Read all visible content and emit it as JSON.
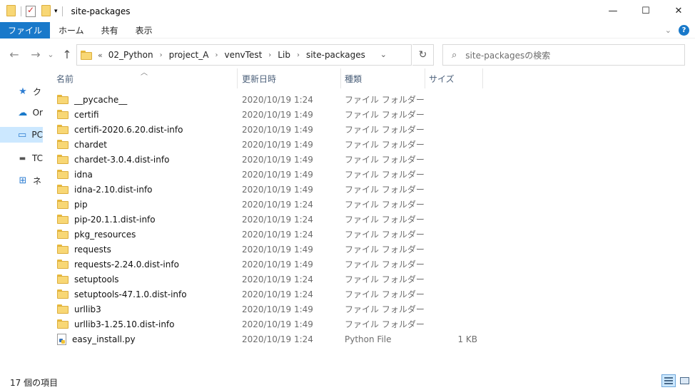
{
  "window": {
    "title": "site-packages",
    "controls": {
      "minimize": "—",
      "maximize": "☐",
      "close": "✕"
    }
  },
  "ribbon": {
    "tabs": [
      "ファイル",
      "ホーム",
      "共有",
      "表示"
    ],
    "help": "?"
  },
  "nav": {
    "back": "←",
    "forward": "→",
    "recent": "⌄",
    "up": "↑",
    "overflow": "«",
    "breadcrumbs": [
      "02_Python",
      "project_A",
      "venvTest",
      "Lib",
      "site-packages"
    ],
    "refresh": "↻",
    "search_placeholder": "site-packagesの検索"
  },
  "navpane": {
    "items": [
      {
        "label": "ク",
        "icon": "star-icon"
      },
      {
        "label": "Or",
        "icon": "cloud-icon"
      },
      {
        "label": "PC",
        "icon": "monitor-icon",
        "selected": true
      },
      {
        "label": "TC",
        "icon": "drive-icon"
      },
      {
        "label": "ネ",
        "icon": "network-icon"
      }
    ]
  },
  "columns": {
    "name": "名前",
    "date": "更新日時",
    "type": "種類",
    "size": "サイズ"
  },
  "files": [
    {
      "name": "__pycache__",
      "date": "2020/10/19 1:24",
      "type": "ファイル フォルダー",
      "size": "",
      "icon": "folder-icon"
    },
    {
      "name": "certifi",
      "date": "2020/10/19 1:49",
      "type": "ファイル フォルダー",
      "size": "",
      "icon": "folder-icon"
    },
    {
      "name": "certifi-2020.6.20.dist-info",
      "date": "2020/10/19 1:49",
      "type": "ファイル フォルダー",
      "size": "",
      "icon": "folder-icon"
    },
    {
      "name": "chardet",
      "date": "2020/10/19 1:49",
      "type": "ファイル フォルダー",
      "size": "",
      "icon": "folder-icon"
    },
    {
      "name": "chardet-3.0.4.dist-info",
      "date": "2020/10/19 1:49",
      "type": "ファイル フォルダー",
      "size": "",
      "icon": "folder-icon"
    },
    {
      "name": "idna",
      "date": "2020/10/19 1:49",
      "type": "ファイル フォルダー",
      "size": "",
      "icon": "folder-icon"
    },
    {
      "name": "idna-2.10.dist-info",
      "date": "2020/10/19 1:49",
      "type": "ファイル フォルダー",
      "size": "",
      "icon": "folder-icon"
    },
    {
      "name": "pip",
      "date": "2020/10/19 1:24",
      "type": "ファイル フォルダー",
      "size": "",
      "icon": "folder-icon"
    },
    {
      "name": "pip-20.1.1.dist-info",
      "date": "2020/10/19 1:24",
      "type": "ファイル フォルダー",
      "size": "",
      "icon": "folder-icon"
    },
    {
      "name": "pkg_resources",
      "date": "2020/10/19 1:24",
      "type": "ファイル フォルダー",
      "size": "",
      "icon": "folder-icon"
    },
    {
      "name": "requests",
      "date": "2020/10/19 1:49",
      "type": "ファイル フォルダー",
      "size": "",
      "icon": "folder-icon"
    },
    {
      "name": "requests-2.24.0.dist-info",
      "date": "2020/10/19 1:49",
      "type": "ファイル フォルダー",
      "size": "",
      "icon": "folder-icon"
    },
    {
      "name": "setuptools",
      "date": "2020/10/19 1:24",
      "type": "ファイル フォルダー",
      "size": "",
      "icon": "folder-icon"
    },
    {
      "name": "setuptools-47.1.0.dist-info",
      "date": "2020/10/19 1:24",
      "type": "ファイル フォルダー",
      "size": "",
      "icon": "folder-icon"
    },
    {
      "name": "urllib3",
      "date": "2020/10/19 1:49",
      "type": "ファイル フォルダー",
      "size": "",
      "icon": "folder-icon"
    },
    {
      "name": "urllib3-1.25.10.dist-info",
      "date": "2020/10/19 1:49",
      "type": "ファイル フォルダー",
      "size": "",
      "icon": "folder-icon"
    },
    {
      "name": "easy_install.py",
      "date": "2020/10/19 1:24",
      "type": "Python File",
      "size": "1 KB",
      "icon": "python-file-icon"
    }
  ],
  "status": {
    "item_count": "17 個の項目"
  }
}
